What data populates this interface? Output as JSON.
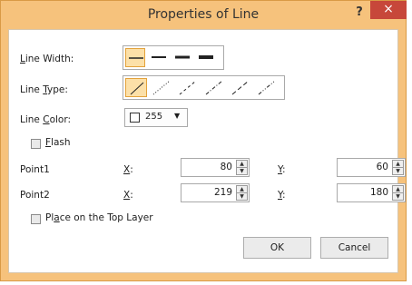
{
  "window": {
    "title": "Properties of Line",
    "help_label": "?",
    "close_label": "×"
  },
  "line_width": {
    "label_mnemonic": "L",
    "label_rest": "ine Width:",
    "options": [
      "thin",
      "medium",
      "thick",
      "extra-thick"
    ],
    "selected_index": 0
  },
  "line_type": {
    "label_prefix": "Line ",
    "label_mnemonic": "T",
    "label_rest": "ype:",
    "options": [
      "solid",
      "dotted",
      "dashed",
      "dash-dot",
      "long-dash",
      "dash-dot-dot"
    ],
    "selected_index": 0
  },
  "line_color": {
    "label_prefix": "Line ",
    "label_mnemonic": "C",
    "label_rest": "olor:",
    "value": "255",
    "swatch_color": "#ffffff",
    "arrow": "▼"
  },
  "flash": {
    "label_mnemonic": "F",
    "label_rest": "lash",
    "checked": false
  },
  "point1": {
    "label": "Point1",
    "x_mnemonic": "X",
    "x_suffix": ":",
    "x_value": "80",
    "y_mnemonic": "Y",
    "y_suffix": ":",
    "y_value": "60"
  },
  "point2": {
    "label": "Point2",
    "x_mnemonic": "X",
    "x_suffix": ":",
    "x_value": "219",
    "y_mnemonic": "Y",
    "y_suffix": ":",
    "y_value": "180"
  },
  "top_layer": {
    "label_prefix": "Pl",
    "label_mnemonic": "a",
    "label_rest": "ce on the Top Layer",
    "checked": false
  },
  "buttons": {
    "ok": "OK",
    "cancel": "Cancel"
  },
  "colors": {
    "frame": "#f6c27c",
    "close": "#c7473a",
    "selected_option": "#fce0a8"
  }
}
